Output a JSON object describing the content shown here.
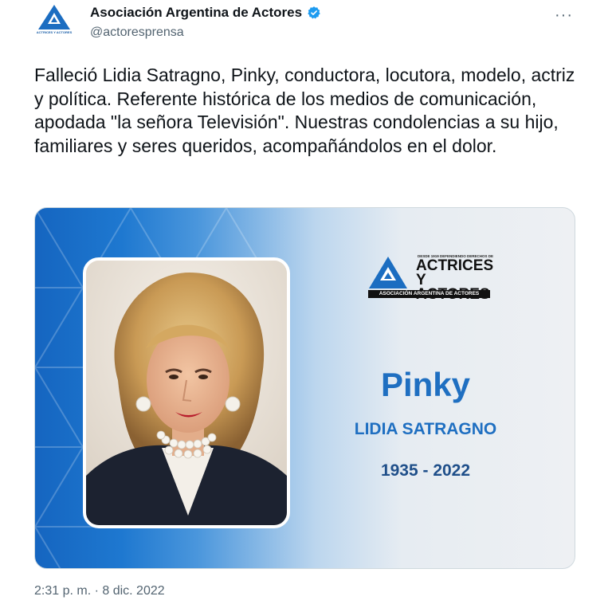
{
  "author": {
    "display_name": "Asociación Argentina de Actores",
    "handle": "@actoresprensa",
    "avatar_text": "ACTRICES Y ACTORES"
  },
  "more_label": "···",
  "tweet_text": "Falleció Lidia Satragno, Pinky, conductora, locutora, modelo, actriz y política. Referente histórica de los medios de comunicación, apodada \"la señora Televisión\". Nuestras condolencias a su hijo, familiares y seres queridos, acompañándolos en el dolor.",
  "media": {
    "logo": {
      "tagline": "DESDE 1919 DEFENDIENDO DERECHOS DE",
      "line1": "ACTRICES",
      "line2": "Y ACTORES",
      "bar": "ASOCIACIÓN ARGENTINA DE ACTORES"
    },
    "name": "Pinky",
    "full_name": "LIDIA SATRAGNO",
    "years": "1935 - 2022"
  },
  "timestamp": "2:31 p. m. · 8 dic. 2022",
  "colors": {
    "brand_blue": "#1f6fc1",
    "verified": "#1d9bf0",
    "muted": "#536471"
  }
}
